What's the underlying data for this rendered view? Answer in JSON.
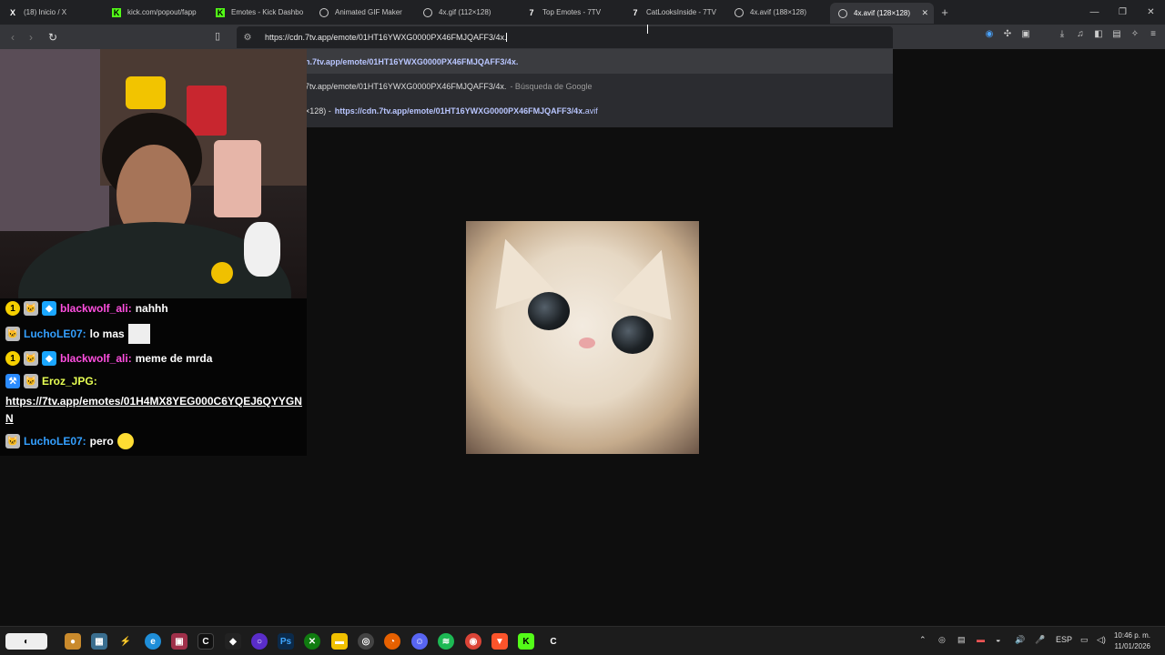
{
  "browser": {
    "tabs": [
      {
        "label": "(18) Inicio / X",
        "icon": "x-logo-icon"
      },
      {
        "label": "kick.com/popout/fapp",
        "icon": "kick-logo-icon"
      },
      {
        "label": "Emotes - Kick Dashbo",
        "icon": "kick-logo-icon"
      },
      {
        "label": "Animated GIF Maker",
        "icon": "ezgif-icon"
      },
      {
        "label": "4x.gif (112×128)",
        "icon": "globe-icon"
      },
      {
        "label": "Top Emotes - 7TV",
        "icon": "7tv-logo-icon"
      },
      {
        "label": "CatLooksInside - 7TV",
        "icon": "7tv-logo-icon"
      },
      {
        "label": "4x.avif (188×128)",
        "icon": "globe-icon"
      },
      {
        "label": "4x.avif (128×128)",
        "icon": "globe-icon"
      }
    ],
    "active_tab_index": 8,
    "address": "https://cdn.7tv.app/emote/01HT16YWXG0000PX46FMJQAFF3/4x.",
    "suggestions": [
      {
        "main": "n.7tv.app/emote/01HT16YWXG0000PX46FMJQAFF3/4x."
      },
      {
        "main": "7tv.app/emote/01HT16YWXG0000PX46FMJQAFF3/4x.",
        "extra": "- Búsqueda de Google"
      },
      {
        "prefix": "×128) -",
        "url_bold": "https://cdn.7tv.app/emote/01HT16YWXG0000PX46FMJQAFF3/4x.",
        "url_tail": "avif"
      }
    ]
  },
  "chat": {
    "messages": [
      {
        "user": "blackwolf_ali:",
        "text": "nahhh",
        "color": "#ff4fe0"
      },
      {
        "user": "LuchoLE07:",
        "text": "lo mas",
        "color": "#34a0ff"
      },
      {
        "user": "blackwolf_ali:",
        "text": "meme de mrda",
        "color": "#ff4fe0"
      },
      {
        "user": "Eroz_JPG:",
        "text": "",
        "color": "#e8ff53"
      },
      {
        "user": "LuchoLE07:",
        "text": "pero",
        "color": "#34a0ff"
      }
    ],
    "link": "https://7tv.app/emotes/01H4MX8YEG000C6YQEJ6QYYGNN"
  },
  "viewer": {
    "image_alt": "cat emote 128x128"
  },
  "taskbar": {
    "tray_lang": "ESP",
    "time": "10:46 p. m.",
    "date": "11/01/2026"
  },
  "colors": {
    "accent_link": "#b9c6ff",
    "tab_bg": "#202124",
    "toolbar_bg": "#35363a"
  }
}
